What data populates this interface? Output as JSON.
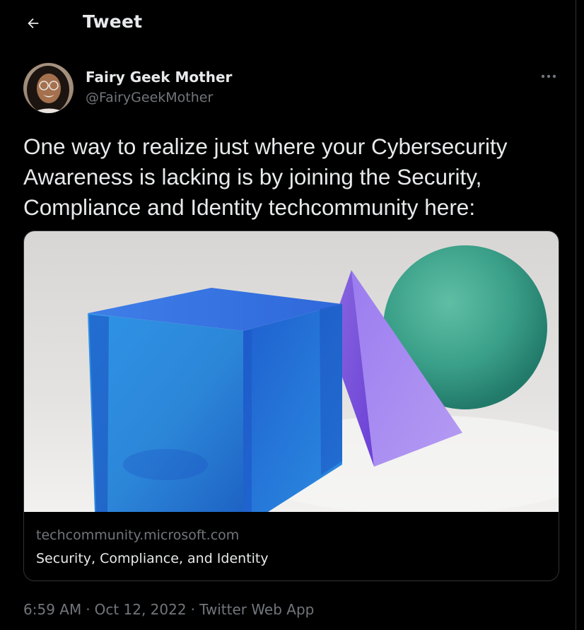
{
  "header": {
    "back_icon": "arrow-left-icon",
    "title": "Tweet"
  },
  "author": {
    "name": "Fairy Geek Mother",
    "handle": "@FairyGeekMother",
    "more_icon": "more-horizontal-icon"
  },
  "tweet": {
    "text": "One way to realize just where your Cybersecurity Awareness is lacking is by joining the Security, Compliance and Identity techcommunity here:"
  },
  "card": {
    "domain": "techcommunity.microsoft.com",
    "title": "Security, Compliance, and Identity"
  },
  "meta": {
    "time": "6:59 AM",
    "date": "Oct 12, 2022",
    "source": "Twitter Web App",
    "separator": "·"
  },
  "colors": {
    "background": "#000000",
    "text_primary": "#e7e9ea",
    "text_secondary": "#71767b",
    "border": "#2f3336"
  }
}
